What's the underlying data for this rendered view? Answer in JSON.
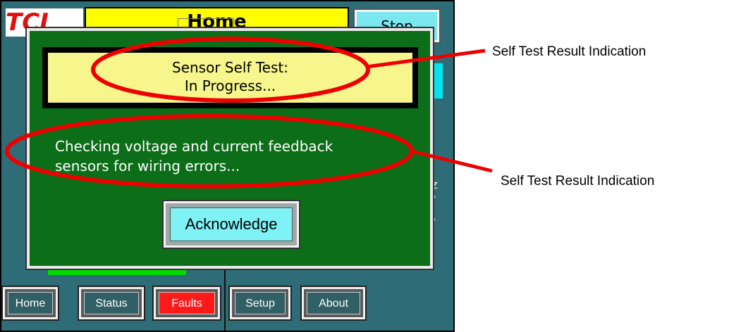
{
  "panel": {
    "logo_text": "TCI",
    "title": "Home",
    "top_right_button": "Stop",
    "bg_right_text": "z\n/\n/"
  },
  "dialog": {
    "result_line1": "Sensor Self Test:",
    "result_line2": "In Progress...",
    "message_line1": "Checking voltage and current feedback",
    "message_line2": "sensors for wiring errors...",
    "ack_label": "Acknowledge"
  },
  "nav": {
    "home": "Home",
    "status": "Status",
    "faults": "Faults",
    "setup": "Setup",
    "about": "About"
  },
  "annotations": {
    "callout_top": "Self Test Result Indication",
    "callout_bottom": "Self Test Result Indication",
    "highlight_color": "#ee0000"
  },
  "colors": {
    "dialog_bg": "#0c6e18",
    "result_bg": "#f6f68c",
    "ack_bg": "#7ef2f5",
    "faults_bg": "#ff1a1a",
    "screen_bg": "#2e6d78"
  }
}
